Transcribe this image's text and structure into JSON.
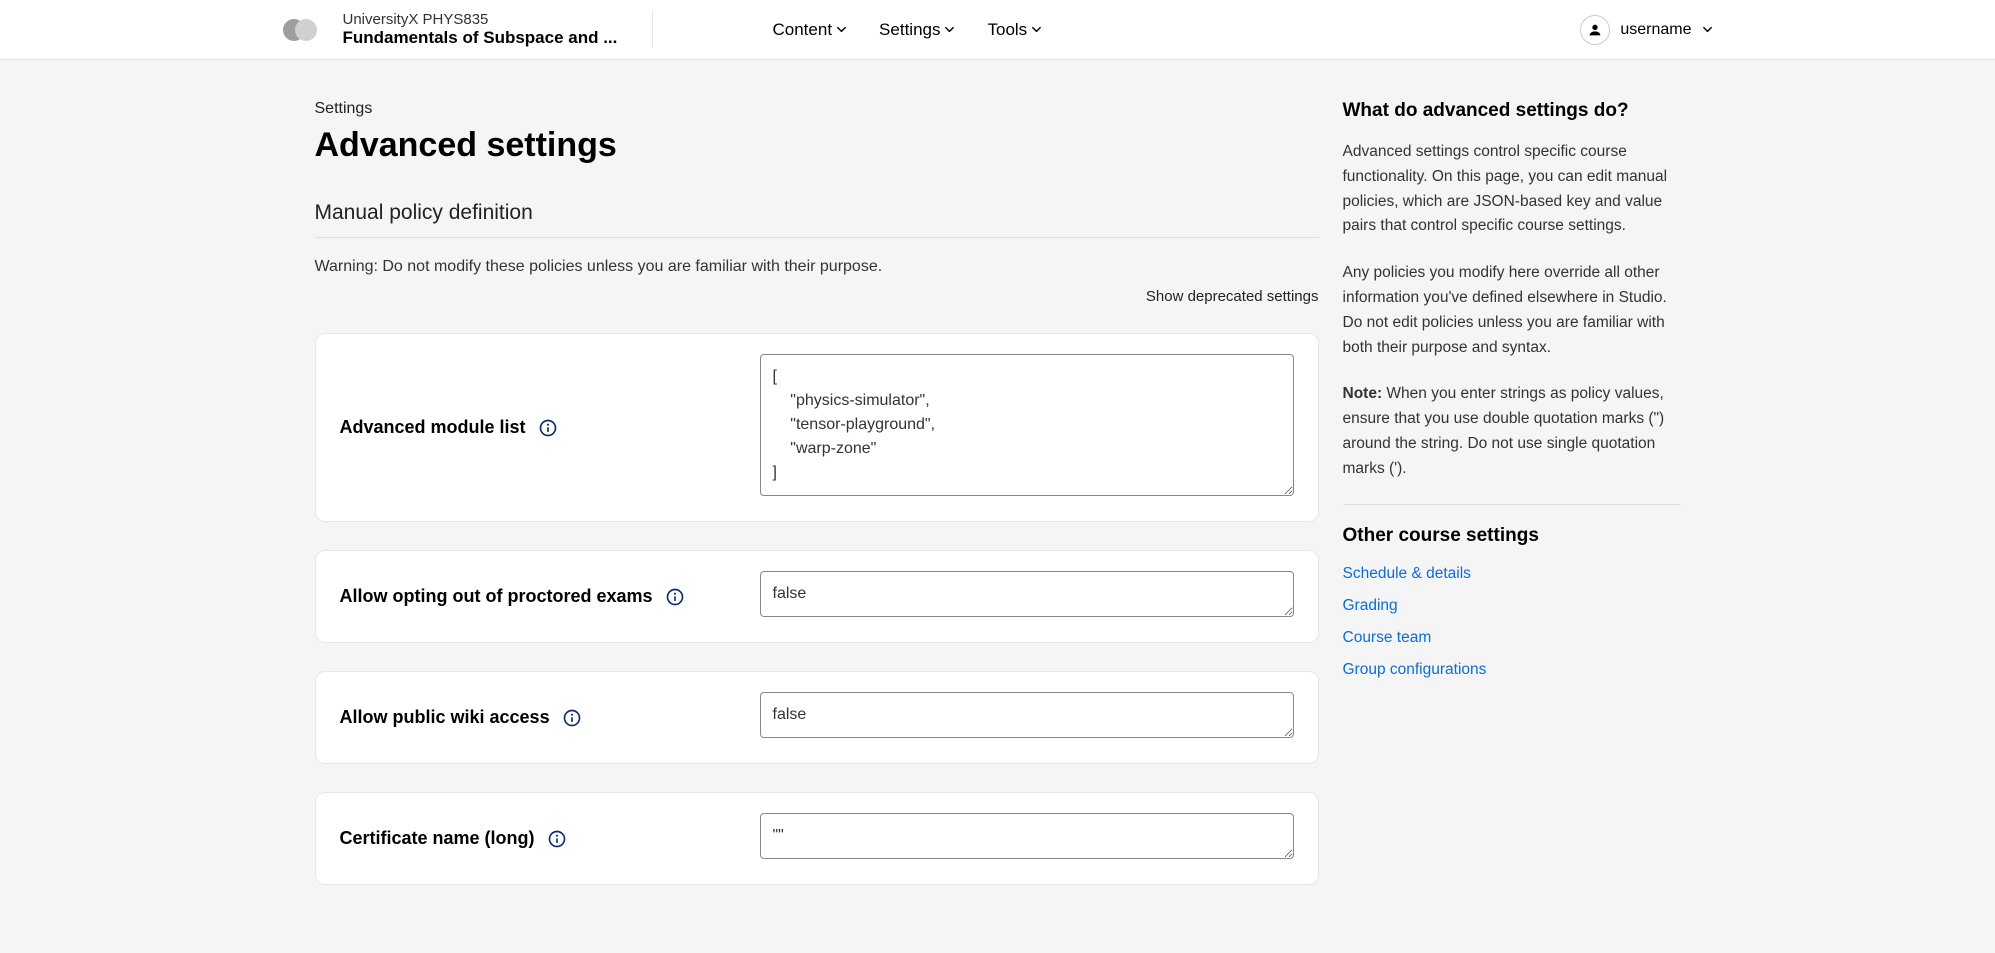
{
  "header": {
    "course_org": "UniversityX PHYS835",
    "course_title": "Fundamentals of Subspace and ...",
    "nav": [
      {
        "label": "Content"
      },
      {
        "label": "Settings"
      },
      {
        "label": "Tools"
      }
    ],
    "username": "username"
  },
  "page": {
    "breadcrumb": "Settings",
    "title": "Advanced settings",
    "section_heading": "Manual policy definition",
    "warning": "Warning: Do not modify these policies unless you are familiar with their purpose.",
    "deprecated_link": "Show deprecated settings"
  },
  "settings": [
    {
      "label": "Advanced module list",
      "value": "[\n    \"physics-simulator\",\n    \"tensor-playground\",\n    \"warp-zone\"\n]",
      "rows": 5
    },
    {
      "label": "Allow opting out of proctored exams",
      "value": "false",
      "rows": 1
    },
    {
      "label": "Allow public wiki access",
      "value": "false",
      "rows": 1
    },
    {
      "label": "Certificate name (long)",
      "value": "\"\"",
      "rows": 1
    }
  ],
  "sidebar": {
    "heading1": "What do advanced settings do?",
    "p1": "Advanced settings control specific course functionality. On this page, you can edit manual policies, which are JSON-based key and value pairs that control specific course settings.",
    "p2": "Any policies you modify here override all other information you've defined elsewhere in Studio. Do not edit policies unless you are familiar with both their purpose and syntax.",
    "note_label": "Note:",
    "p3": " When you enter strings as policy values, ensure that you use double quotation marks (\") around the string. Do not use single quotation marks (').",
    "heading2": "Other course settings",
    "links": [
      "Schedule & details",
      "Grading",
      "Course team",
      "Group configurations"
    ]
  }
}
